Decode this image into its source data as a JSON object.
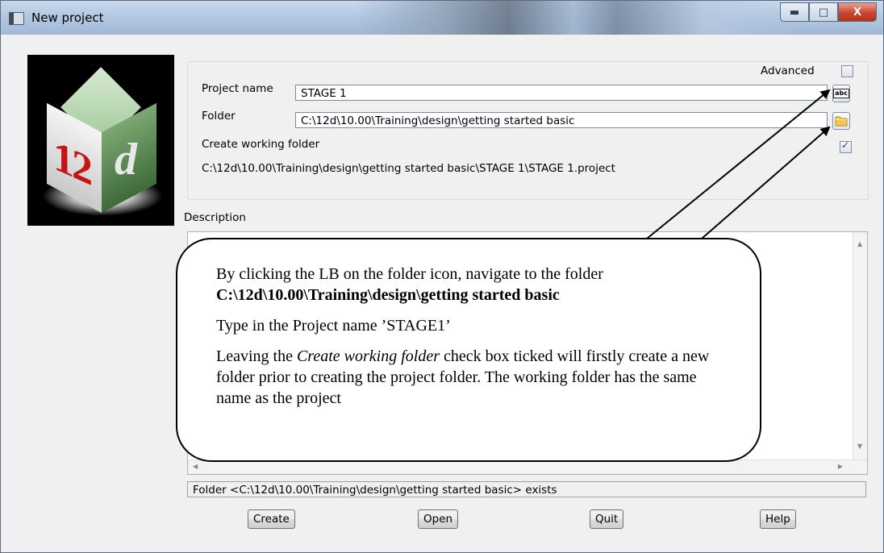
{
  "window": {
    "title": "New project",
    "minimize_glyph": "▬",
    "maximize_glyph": "□",
    "close_glyph": "X"
  },
  "logo": {
    "left_text": "12",
    "right_text": "d"
  },
  "form": {
    "advanced_label": "Advanced",
    "advanced_checked": false,
    "project_name_label": "Project name",
    "project_name_value": "STAGE 1",
    "folder_label": "Folder",
    "folder_value": "C:\\12d\\10.00\\Training\\design\\getting started basic",
    "create_working_folder_label": "Create working folder",
    "create_working_folder_checked": true,
    "project_path": "C:\\12d\\10.00\\Training\\design\\getting started basic\\STAGE 1\\STAGE 1.project",
    "abc_icon_text": "abc"
  },
  "description": {
    "label": "Description",
    "value": ""
  },
  "status": "Folder <C:\\12d\\10.00\\Training\\design\\getting started basic> exists",
  "buttons": {
    "create": "Create",
    "open": "Open",
    "quit": "Quit",
    "help": "Help"
  },
  "callout": {
    "line1": "By clicking the LB on the folder icon, navigate to the folder",
    "line1_path": "C:\\12d\\10.00\\Training\\design\\getting started basic",
    "line2": "Type in the Project name ’STAGE1’",
    "line3_pre": "Leaving the ",
    "line3_em": "Create working folder",
    "line3_post": " check box ticked will firstly create a new folder prior to creating the project folder. The working folder has the same name as the project"
  },
  "colors": {
    "folder_icon": "#f2c94c",
    "close_button": "#c9442c",
    "title_bar": "#b3c8e2"
  }
}
